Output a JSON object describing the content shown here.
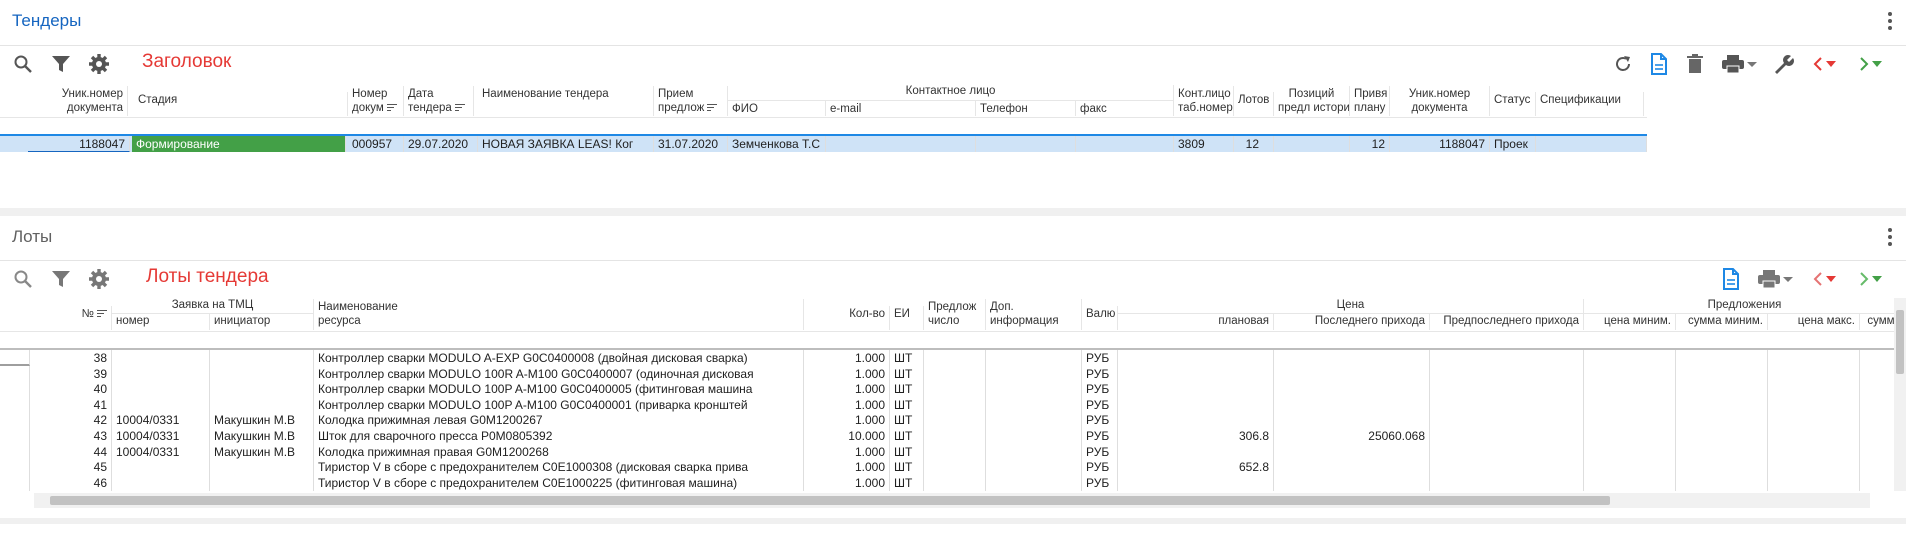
{
  "tenders_panel": {
    "title": "Тендеры",
    "caption": "Заголовок",
    "headers": {
      "unique_doc": "Уник.номер документа",
      "stage": "Стадия",
      "doc_number": "Номер докум",
      "tender_date": "Дата тендера",
      "tender_name": "Наименование тендера",
      "receipt": "Прием предлож",
      "contact_group": "Контактное лицо",
      "fio": "ФИО",
      "email": "e-mail",
      "phone": "Телефон",
      "fax": "факс",
      "contact_tab": "Конт.лицо таб.номер",
      "lots": "Лотов",
      "positions": "Позиций",
      "positions_sub": "предл историч",
      "plan": "Привя плану",
      "unique_doc2": "Уник.номер документа",
      "status": "Статус",
      "specs": "Спецификации"
    },
    "row": {
      "unique_doc": "1188047",
      "stage": "Формирование",
      "doc_number": "000957",
      "tender_date": "29.07.2020",
      "tender_name": "НОВАЯ ЗАЯВКА  LEAS!  Ког",
      "receipt": "31.07.2020",
      "fio": "Земченкова Т.С",
      "contact_tab": "3809",
      "lots": "12",
      "plan": "12",
      "unique_doc2": "1188047",
      "status": "Проек"
    },
    "colors": {
      "title": "#1565c0",
      "caption": "#e53935",
      "stage_bg": "#43a047",
      "selected_row": "#cfe3f7"
    }
  },
  "lots_panel": {
    "title": "Лоты",
    "caption": "Лоты тендера",
    "headers": {
      "num": "№",
      "request_group": "Заявка на ТМЦ",
      "req_number": "номер",
      "initiator": "инициатор",
      "resource": "Наименование ресурса",
      "qty": "Кол-во",
      "unit": "ЕИ",
      "offers_count_a": "Предлож",
      "offers_count_b": "число",
      "extra_info": "Доп. информация",
      "currency": "Валю",
      "price_group": "Цена",
      "planned": "плановая",
      "last_income": "Последнего прихода",
      "prev_income": "Предпоследнего прихода",
      "offers_group": "Предложения",
      "price_min": "цена миним.",
      "sum_min": "сумма миним.",
      "price_max": "цена макс.",
      "sum_max": "сумма"
    },
    "rows": [
      {
        "num": "38",
        "req": "",
        "initiator": "",
        "resource": "Контроллер сварки MODULO A-EXP G0C0400008 (двойная дисковая сварка)",
        "qty": "1.000",
        "unit": "ШТ",
        "currency": "РУБ",
        "planned": "",
        "last": ""
      },
      {
        "num": "39",
        "req": "",
        "initiator": "",
        "resource": "Контроллер сварки MODULO 100R A-M100 G0C0400007 (одиночная дисковая",
        "qty": "1.000",
        "unit": "ШТ",
        "currency": "РУБ",
        "planned": "",
        "last": ""
      },
      {
        "num": "40",
        "req": "",
        "initiator": "",
        "resource": "Контроллер сварки MODULO 100P A-M100 G0C0400005 (фитинговая машина",
        "qty": "1.000",
        "unit": "ШТ",
        "currency": "РУБ",
        "planned": "",
        "last": ""
      },
      {
        "num": "41",
        "req": "",
        "initiator": "",
        "resource": "Контроллер сварки MODULO 100P A-M100 G0C0400001 (приварка кронштей",
        "qty": "1.000",
        "unit": "ШТ",
        "currency": "РУБ",
        "planned": "",
        "last": ""
      },
      {
        "num": "42",
        "req": "10004/0331",
        "initiator": "Макушкин М.В",
        "resource": "Колодка прижимная левая G0M1200267",
        "qty": "1.000",
        "unit": "ШТ",
        "currency": "РУБ",
        "planned": "",
        "last": ""
      },
      {
        "num": "43",
        "req": "10004/0331",
        "initiator": "Макушкин М.В",
        "resource": "Шток для сварочного пресса P0M0805392",
        "qty": "10.000",
        "unit": "ШТ",
        "currency": "РУБ",
        "planned": "306.8",
        "last": "25060.068"
      },
      {
        "num": "44",
        "req": "10004/0331",
        "initiator": "Макушкин М.В",
        "resource": "Колодка прижимная правая G0M1200268",
        "qty": "1.000",
        "unit": "ШТ",
        "currency": "РУБ",
        "planned": "",
        "last": ""
      },
      {
        "num": "45",
        "req": "",
        "initiator": "",
        "resource": "Тиристор V в сборе с предохранителем C0E1000308 (дисковая сварка прива",
        "qty": "1.000",
        "unit": "ШТ",
        "currency": "РУБ",
        "planned": "652.8",
        "last": ""
      },
      {
        "num": "46",
        "req": "",
        "initiator": "",
        "resource": "Тиристор V в сборе с предохранителем C0E1000225 (фитинговая машина)",
        "qty": "1.000",
        "unit": "ШТ",
        "currency": "РУБ",
        "planned": "",
        "last": ""
      }
    ],
    "colors": {
      "title": "#616161",
      "caption": "#e53935"
    }
  },
  "icons": {
    "toolbar_left": [
      "search-icon",
      "filter-icon",
      "gear-icon"
    ],
    "toolbar_right_tenders": [
      "refresh-icon",
      "new-document-icon",
      "trash-icon",
      "print-icon",
      "wrench-icon",
      "prev-arrow-icon",
      "next-arrow-icon"
    ],
    "toolbar_right_lots": [
      "new-document-icon",
      "print-icon",
      "prev-arrow-icon",
      "next-arrow-icon"
    ]
  }
}
